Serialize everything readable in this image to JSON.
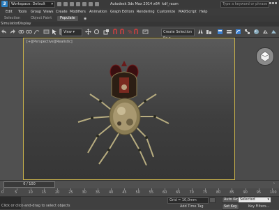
{
  "titlebar": {
    "workspace_label": "Workspace: Default",
    "title": "Autodesk 3ds Max 2014 x64",
    "file_name": "kdf_raum",
    "search_placeholder": "Type a keyword or phrase"
  },
  "menu": {
    "items": [
      "Edit",
      "Tools",
      "Group",
      "Views",
      "Create",
      "Modifiers",
      "Animation",
      "Graph Editors",
      "Rendering",
      "Customize",
      "MAXScript",
      "Help"
    ]
  },
  "ribbon": {
    "tabs": [
      "Selection",
      "Object Paint",
      "Populate"
    ]
  },
  "explorer": {
    "tabs": [
      "Simulation",
      "Display"
    ]
  },
  "toolbar": {
    "filter_label": "View",
    "selection_set_label": "Create Selection Se"
  },
  "viewport": {
    "label": "[+][Perspective][Realistic]"
  },
  "timeline": {
    "frame_label": "0 / 100",
    "ruler_ticks": [
      "0",
      "5",
      "10",
      "15",
      "20",
      "25",
      "30",
      "35",
      "40",
      "45",
      "50",
      "55",
      "60",
      "65",
      "70",
      "75",
      "80",
      "85",
      "90",
      "95",
      "100"
    ]
  },
  "status": {
    "message": "Click or click-and-drag to select objects",
    "coordinate": "Grid = 10,0mm",
    "add_time_tag": "Add Time Tag",
    "auto_key": "Auto Key",
    "set_key": "Set Key",
    "selected_dropdown": "Selected",
    "key_filters": "Key Filters..."
  },
  "colors": {
    "viewport_border": "#c9b24a",
    "accent": "#2c7fc0"
  }
}
